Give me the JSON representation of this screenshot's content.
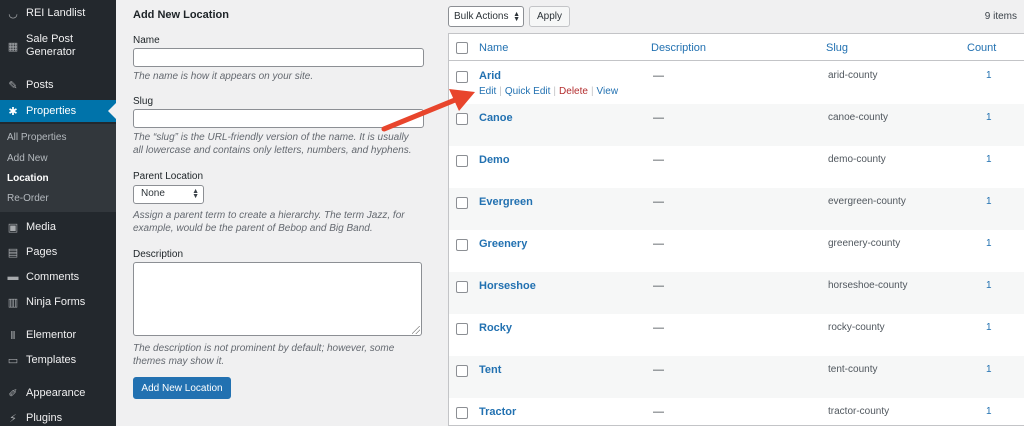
{
  "sidebar": {
    "items": [
      {
        "id": "site",
        "label": "REI Landlist",
        "icon": "smile-icon"
      },
      {
        "id": "sale-post",
        "label": "Sale Post Generator",
        "icon": "store-icon"
      },
      {
        "id": "posts",
        "label": "Posts",
        "icon": "pin-icon"
      },
      {
        "id": "properties",
        "label": "Properties",
        "icon": "palm-tree-icon",
        "active": true
      },
      {
        "id": "media",
        "label": "Media",
        "icon": "media-icon"
      },
      {
        "id": "pages",
        "label": "Pages",
        "icon": "pages-icon"
      },
      {
        "id": "comments",
        "label": "Comments",
        "icon": "comment-icon"
      },
      {
        "id": "ninja-forms",
        "label": "Ninja Forms",
        "icon": "form-icon"
      },
      {
        "id": "elementor",
        "label": "Elementor",
        "icon": "elementor-icon"
      },
      {
        "id": "templates",
        "label": "Templates",
        "icon": "folder-icon"
      },
      {
        "id": "appearance",
        "label": "Appearance",
        "icon": "brush-icon"
      },
      {
        "id": "plugins",
        "label": "Plugins",
        "icon": "plug-icon"
      }
    ],
    "submenu": [
      {
        "label": "All Properties"
      },
      {
        "label": "Add New"
      },
      {
        "label": "Location",
        "current": true
      },
      {
        "label": "Re-Order"
      }
    ]
  },
  "form": {
    "title": "Add New Location",
    "name_label": "Name",
    "name_value": "",
    "name_desc": "The name is how it appears on your site.",
    "slug_label": "Slug",
    "slug_value": "",
    "slug_desc": "The “slug” is the URL-friendly version of the name. It is usually all lowercase and contains only letters, numbers, and hyphens.",
    "parent_label": "Parent Location",
    "parent_selected": "None",
    "parent_desc": "Assign a parent term to create a hierarchy. The term Jazz, for example, would be the parent of Bebop and Big Band.",
    "description_label": "Description",
    "description_value": "",
    "description_desc": "The description is not prominent by default; however, some themes may show it.",
    "submit_label": "Add New Location"
  },
  "list": {
    "bulk_actions": "Bulk Actions",
    "apply": "Apply",
    "items_count": "9 items",
    "columns": {
      "name": "Name",
      "description": "Description",
      "slug": "Slug",
      "count": "Count"
    },
    "row_actions": {
      "edit": "Edit",
      "quick_edit": "Quick Edit",
      "delete": "Delete",
      "view": "View"
    },
    "rows": [
      {
        "name": "Arid",
        "description": "—",
        "slug": "arid-county",
        "count": "1"
      },
      {
        "name": "Canoe",
        "description": "—",
        "slug": "canoe-county",
        "count": "1"
      },
      {
        "name": "Demo",
        "description": "—",
        "slug": "demo-county",
        "count": "1"
      },
      {
        "name": "Evergreen",
        "description": "—",
        "slug": "evergreen-county",
        "count": "1"
      },
      {
        "name": "Greenery",
        "description": "—",
        "slug": "greenery-county",
        "count": "1"
      },
      {
        "name": "Horseshoe",
        "description": "—",
        "slug": "horseshoe-county",
        "count": "1"
      },
      {
        "name": "Rocky",
        "description": "—",
        "slug": "rocky-county",
        "count": "1"
      },
      {
        "name": "Tent",
        "description": "—",
        "slug": "tent-county",
        "count": "1"
      },
      {
        "name": "Tractor",
        "description": "—",
        "slug": "tractor-county",
        "count": "1"
      }
    ]
  },
  "colors": {
    "sidebar_bg": "#23282d",
    "active_menu": "#0073aa",
    "link": "#2271b1",
    "delete": "#b32d2e",
    "annotation_arrow": "#e8452c"
  }
}
